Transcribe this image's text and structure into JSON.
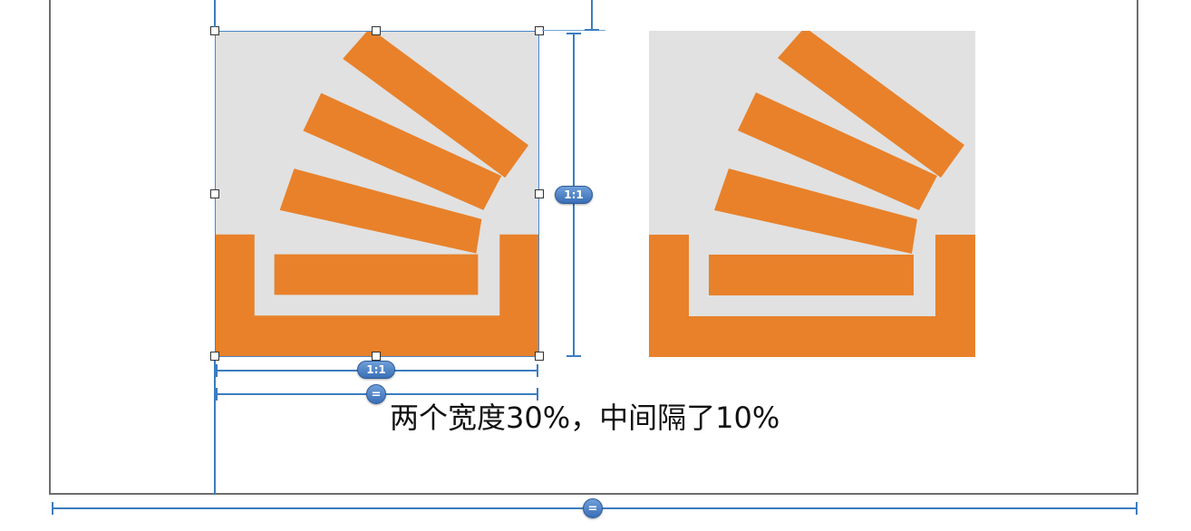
{
  "canvas": {
    "label_text": "两个宽度30%，中间隔了10%"
  },
  "constraints": {
    "aspect_ratio_label": "1:1",
    "width_ratio_label": "1:1",
    "equal_width_label": "=",
    "bottom_equal_label": "="
  },
  "colors": {
    "logo_orange": "#e8812a",
    "logo_background": "#e1e1e1",
    "constraint_blue": "#3b7dbf",
    "frame_border": "#6e6e6e"
  },
  "images": [
    {
      "name": "stackoverflow-logo-left",
      "selected": true
    },
    {
      "name": "stackoverflow-logo-right",
      "selected": false
    }
  ]
}
